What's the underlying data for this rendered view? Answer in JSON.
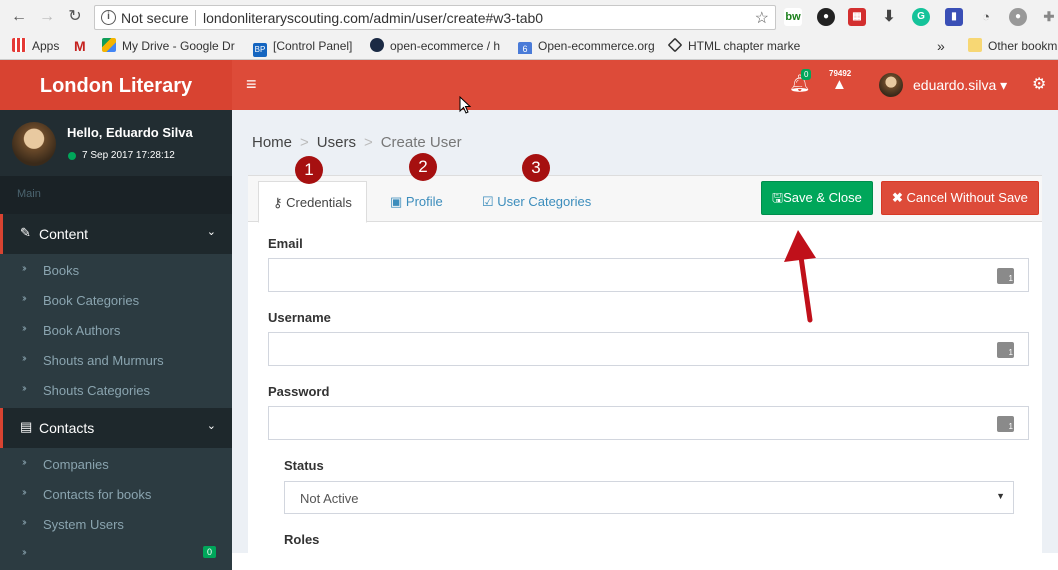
{
  "browser": {
    "security_label": "Not secure",
    "url": "londonliteraryscouting.com/admin/user/create#w3-tab0",
    "bookmarks": [
      {
        "label": "Apps"
      },
      {
        "label": ""
      },
      {
        "label": "My Drive - Google Dr"
      },
      {
        "label": "[Control Panel]"
      },
      {
        "label": "open-ecommerce / h"
      },
      {
        "label": "Open-ecommerce.org"
      },
      {
        "label": "HTML chapter marke"
      },
      {
        "label": "»"
      },
      {
        "label": "Other bookm"
      }
    ]
  },
  "sidebar": {
    "brand": "London Literary",
    "hello": "Hello, Eduardo Silva",
    "timestamp": "7 Sep 2017 17:28:12",
    "main_label": "Main",
    "sections": [
      {
        "label": "Content",
        "items": [
          "Books",
          "Book Categories",
          "Book Authors",
          "Shouts and Murmurs",
          "Shouts Categories"
        ]
      },
      {
        "label": "Contacts",
        "items": [
          "Companies",
          "Contacts for books",
          "System Users"
        ]
      }
    ],
    "partial_item_badge": "0"
  },
  "topbar": {
    "bell_count": "0",
    "warning_count": "79492",
    "username": "eduardo.silva ▾"
  },
  "breadcrumb": {
    "home": "Home",
    "users": "Users",
    "current": "Create User"
  },
  "tabs": [
    {
      "label": "Credentials",
      "number": "1"
    },
    {
      "label": "Profile",
      "number": "2"
    },
    {
      "label": "User Categories",
      "number": "3"
    }
  ],
  "buttons": {
    "save": "Save & Close",
    "cancel": "Cancel Without Save"
  },
  "form": {
    "email_label": "Email",
    "email_value": "",
    "username_label": "Username",
    "username_value": "",
    "password_label": "Password",
    "password_value": "",
    "status_label": "Status",
    "status_value": "Not Active",
    "roles_label": "Roles"
  },
  "colors": {
    "brand": "#d84331",
    "topbar": "#dd4b39",
    "sidebar": "#2c3b41",
    "save": "#00a65a",
    "cancel": "#dd4b39",
    "annotation": "#a61010"
  }
}
